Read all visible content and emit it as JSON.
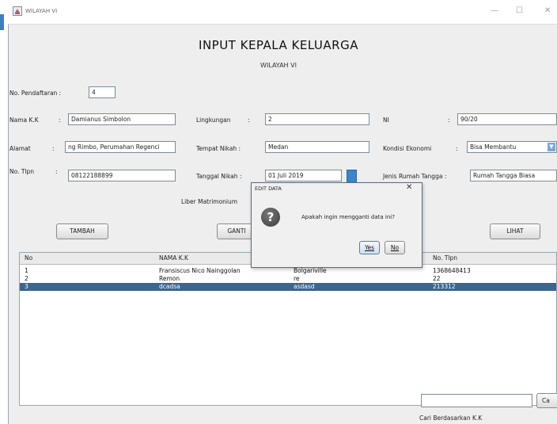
{
  "window": {
    "title": "WILAYAH VI",
    "minimize_symbol": "—",
    "maximize_symbol": "☐",
    "close_symbol": "✕"
  },
  "header": {
    "title": "INPUT KEPALA KELUARGA",
    "subtitle": "WILAYAH VI"
  },
  "form": {
    "no_pendaftaran": {
      "label": "No. Pendaftaran :",
      "value": "4"
    },
    "nama_kk": {
      "label": "Nama K.K",
      "colon": ":",
      "value": "Damianus Simbolon"
    },
    "alamat": {
      "label": "Alamat",
      "colon": ":",
      "value": "ng Rimbo, Perumahan Regenci"
    },
    "no_tlpn": {
      "label": "No. Tlpn",
      "colon": ":",
      "value": "08122188899"
    },
    "lingkungan": {
      "label": "Lingkungan",
      "colon": ":",
      "value": "2"
    },
    "tempat_nikah": {
      "label": "Tempat Nikah :",
      "value": "Medan"
    },
    "tanggal_nikah": {
      "label": "Tanggal Nikah :",
      "value": "01 Juli 2019"
    },
    "liber_matrimonium": {
      "label": "Liber Matrimonium"
    },
    "ni": {
      "label": "NI",
      "colon": ":",
      "value": "90/20"
    },
    "kondisi_ekonomi": {
      "label": "Kondisi Ekonomi",
      "colon": ":",
      "value": "Bisa Membantu"
    },
    "jenis_rumah_tangga": {
      "label": "Jenis Rumah Tangga :",
      "value": "Rumah Tangga Biasa"
    }
  },
  "buttons": {
    "tambah": "TAMBAH",
    "ganti": "GANTI",
    "lihat": "LIHAT",
    "cari": "Ca"
  },
  "table": {
    "columns": [
      "No",
      "NAMA K.K",
      "No. Tlpn"
    ],
    "rows": [
      {
        "no": "1",
        "nama": "Fransiscus Nico Nainggolan",
        "extra": "Bolgariville",
        "tlpn": "1368648413",
        "selected": false
      },
      {
        "no": "2",
        "nama": "Remon",
        "extra": "re",
        "tlpn": "22",
        "selected": false
      },
      {
        "no": "3",
        "nama": "dcadsa",
        "extra": "asdasd",
        "tlpn": "213312",
        "selected": true
      }
    ]
  },
  "search": {
    "value": "",
    "label": "Cari Berdasarkan K.K"
  },
  "dialog": {
    "title": "EDIT DATA",
    "close_symbol": "✕",
    "message": "Apakah ingin mengganti data ini?",
    "icon": "question-icon",
    "icon_glyph": "?",
    "yes_label": "Yes",
    "no_label": "No"
  },
  "colors": {
    "selection": "#3b6690",
    "window_bg": "#eeeeee",
    "calendar_button": "#3a86c8"
  }
}
